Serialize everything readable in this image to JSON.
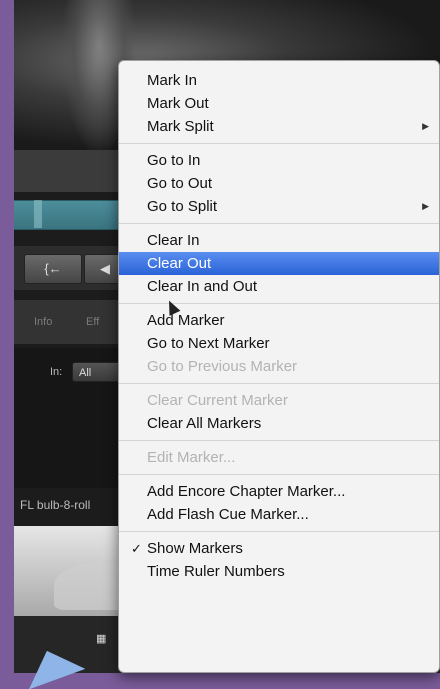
{
  "background_app": {
    "in_label": "In:",
    "in_value": "All",
    "tab_info": "Info",
    "tab_effects": "Eff",
    "clip_name": "FL bulb-8-roll"
  },
  "menu": {
    "groups": [
      [
        {
          "label": "Mark In",
          "disabled": false
        },
        {
          "label": "Mark Out",
          "disabled": false
        },
        {
          "label": "Mark Split",
          "disabled": false,
          "submenu": true
        }
      ],
      [
        {
          "label": "Go to In",
          "disabled": false
        },
        {
          "label": "Go to Out",
          "disabled": false
        },
        {
          "label": "Go to Split",
          "disabled": false,
          "submenu": true
        }
      ],
      [
        {
          "label": "Clear In",
          "disabled": false
        },
        {
          "label": "Clear Out",
          "disabled": false,
          "highlighted": true
        },
        {
          "label": "Clear In and Out",
          "disabled": false
        }
      ],
      [
        {
          "label": "Add Marker",
          "disabled": false
        },
        {
          "label": "Go to Next Marker",
          "disabled": false
        },
        {
          "label": "Go to Previous Marker",
          "disabled": true
        }
      ],
      [
        {
          "label": "Clear Current Marker",
          "disabled": true
        },
        {
          "label": "Clear All Markers",
          "disabled": false
        }
      ],
      [
        {
          "label": "Edit Marker...",
          "disabled": true
        }
      ],
      [
        {
          "label": "Add Encore Chapter Marker...",
          "disabled": false
        },
        {
          "label": "Add Flash Cue Marker...",
          "disabled": false
        }
      ],
      [
        {
          "label": "Show Markers",
          "disabled": false,
          "checked": true
        },
        {
          "label": "Time Ruler Numbers",
          "disabled": false
        }
      ]
    ],
    "submenu_glyph": "▶",
    "check_glyph": "✓",
    "highlight_color": "#2a63d6"
  }
}
